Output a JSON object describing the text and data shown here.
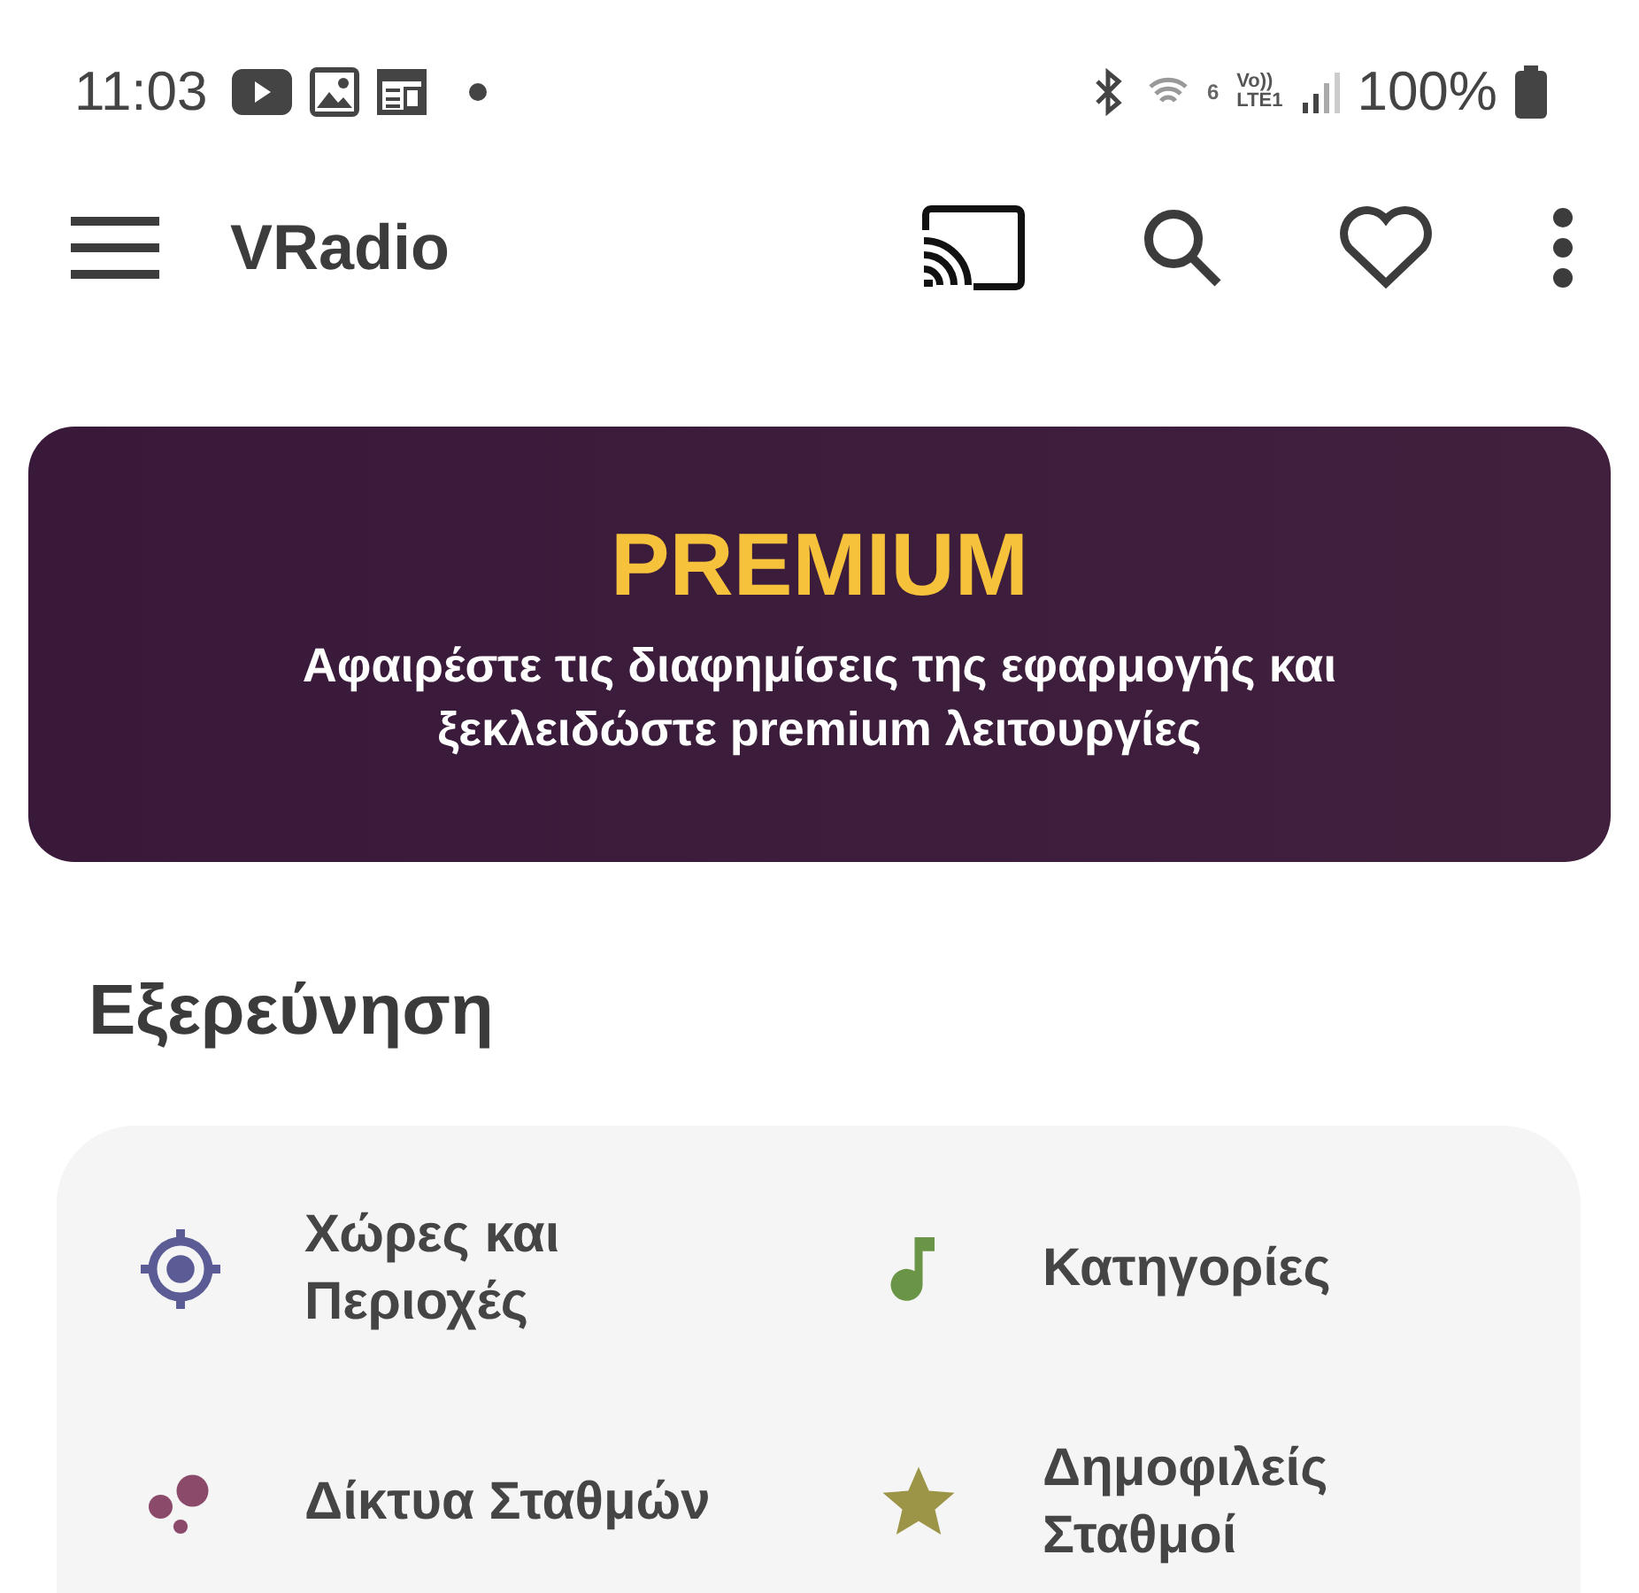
{
  "status_bar": {
    "time": "11:03",
    "network_number": "6",
    "volte_top": "Vo))",
    "volte_bottom": "LTE1",
    "battery": "100%"
  },
  "toolbar": {
    "title": "VRadio"
  },
  "premium": {
    "title": "PREMIUM",
    "text": "Αφαιρέστε τις διαφημίσεις της εφαρμογής και ξεκλειδώστε premium λειτουργίες"
  },
  "section": {
    "title": "Εξερεύνηση"
  },
  "explore_items": [
    {
      "label": "Χώρες και Περιοχές",
      "kind": "target",
      "color": "#5b5b95"
    },
    {
      "label": "Κατηγορίες",
      "kind": "note",
      "color": "#6a9446"
    },
    {
      "label": "Δίκτυα Σταθμών",
      "kind": "bubbles",
      "color": "#8c4a6a"
    },
    {
      "label": "Δημοφιλείς Σταθμοί",
      "kind": "star",
      "color": "#9c9446"
    }
  ]
}
